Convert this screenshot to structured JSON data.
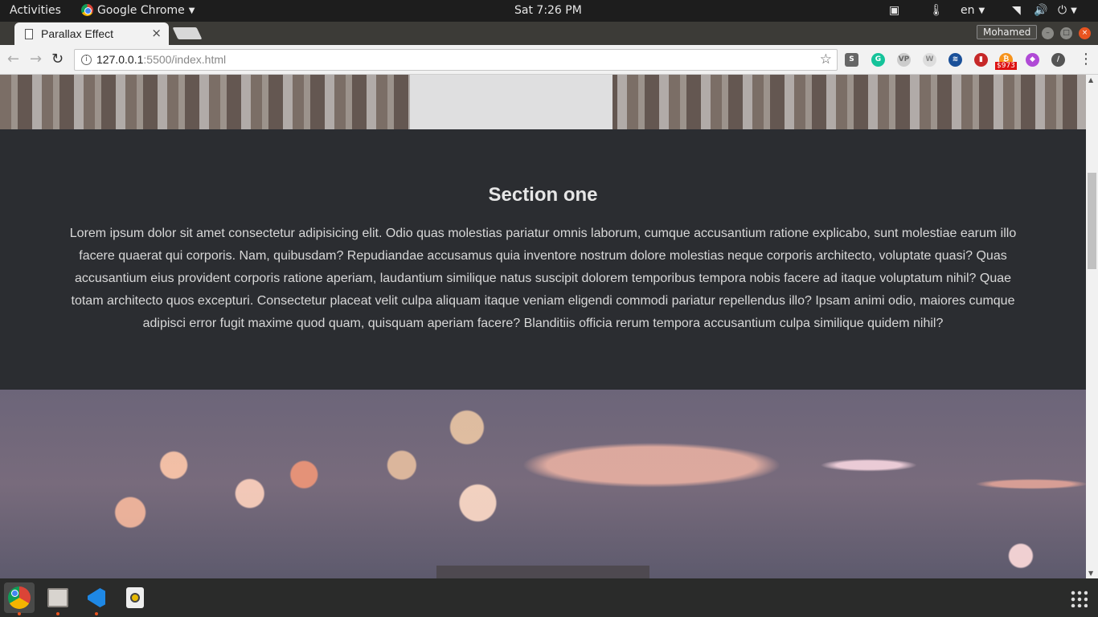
{
  "system_bar": {
    "activities": "Activities",
    "app_name": "Google Chrome",
    "clock": "Sat  7:26 PM",
    "language": "en"
  },
  "browser": {
    "tab_title": "Parallax Effect",
    "profile_name": "Mohamed",
    "url_host": "127.0.0.1",
    "url_rest": ":5500/index.html",
    "extension_badge": "$973"
  },
  "page": {
    "section_heading": "Section one",
    "section_text": "Lorem ipsum dolor sit amet consectetur adipisicing elit. Odio quas molestias pariatur omnis laborum, cumque accusantium ratione explicabo, sunt molestiae earum illo facere quaerat qui corporis. Nam, quibusdam? Repudiandae accusamus quia inventore nostrum dolore molestias neque corporis architecto, voluptate quasi? Quas accusantium eius provident corporis ratione aperiam, laudantium similique natus suscipit dolorem temporibus tempora nobis facere ad itaque voluptatum nihil? Quae totam architecto quos excepturi. Consectetur placeat velit culpa aliquam itaque veniam eligendi commodi pariatur repellendus illo? Ipsam animi odio, maiores cumque adipisci error fugit maxime quod quam, quisquam aperiam facere? Blanditiis officia rerum tempora accusantium culpa similique quidem nihil?"
  },
  "icons": {
    "tab_close": "×",
    "back": "←",
    "forward": "→",
    "reload": "↻",
    "info": "i",
    "bookmark_star": "☆",
    "menu": "⋮",
    "scroll_up": "▲",
    "scroll_down": "▼"
  },
  "colors": {
    "section_bg": "#2b2d31",
    "section_text": "#d8d8d8"
  }
}
